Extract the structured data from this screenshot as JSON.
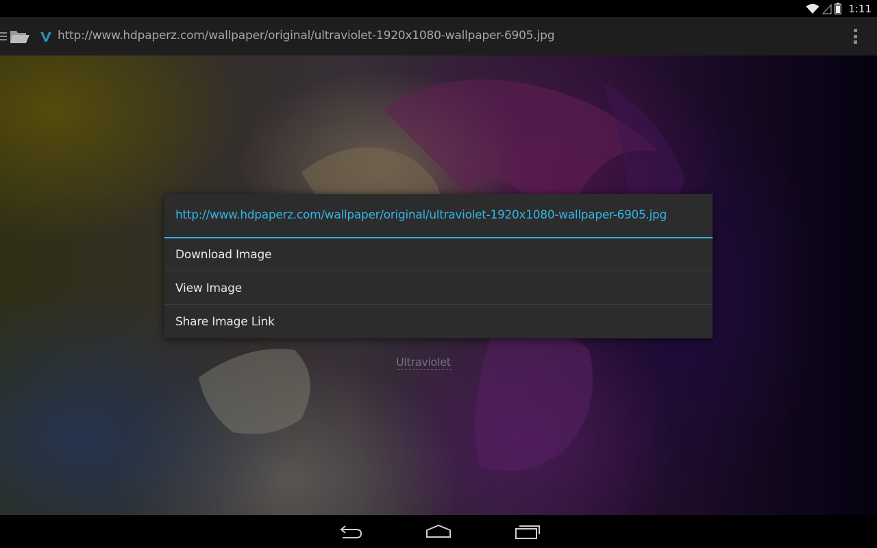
{
  "status_bar": {
    "time": "1:11",
    "icons": [
      "wifi-icon",
      "signal-icon",
      "battery-icon"
    ]
  },
  "url_bar": {
    "url": "http://www.hdpaperz.com/wallpaper/original/ultraviolet-1920x1080-wallpaper-6905.jpg",
    "icons": [
      "menu-icon",
      "folder-icon",
      "site-favicon",
      "overflow-menu-icon"
    ]
  },
  "content": {
    "watermark_text": "Ultraviolet"
  },
  "context_menu": {
    "title": "http://www.hdpaperz.com/wallpaper/original/ultraviolet-1920x1080-wallpaper-6905.jpg",
    "items": [
      {
        "label": "Download Image"
      },
      {
        "label": "View Image"
      },
      {
        "label": "Share Image Link"
      }
    ]
  },
  "nav_bar": {
    "icons": [
      "back-icon",
      "home-icon",
      "recent-apps-icon"
    ]
  },
  "colors": {
    "accent": "#33b5e5",
    "dialog_bg": "#2c2c2d",
    "url_bar_bg": "#1e1e1e"
  }
}
